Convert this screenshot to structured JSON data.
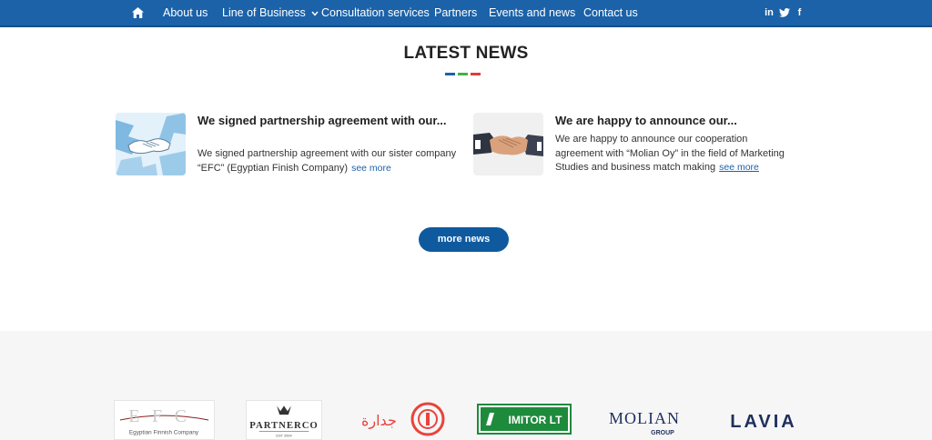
{
  "nav": {
    "home_icon": "home-icon",
    "items": [
      {
        "label": "About us"
      },
      {
        "label": "Line of Business",
        "icon": "chevron-down-icon"
      },
      {
        "label": "Consultation services"
      },
      {
        "label": "Partners"
      },
      {
        "label": "Events and news"
      },
      {
        "label": "Contact us"
      }
    ],
    "social": [
      {
        "label": "in",
        "icon": "linkedin-icon"
      },
      {
        "label": "",
        "icon": "twitter-icon"
      },
      {
        "label": "f",
        "icon": "facebook-icon"
      }
    ],
    "bg_color": "#1b62a8"
  },
  "latest_news": {
    "title": "LATEST NEWS",
    "dash_colors": [
      "#1b62a8",
      "#3cb44b",
      "#e23b3b"
    ],
    "cards": [
      {
        "title": "We signed partnership agreement with our...",
        "excerpt": "We signed partnership agreement with our sister company “EFC” (Egyptian Finish Company)",
        "see_more": "see more",
        "thumb_icon": "puzzle-handshake-image"
      },
      {
        "title": "We are happy to announce our...",
        "excerpt": "We are happy to announce our cooperation agreement with “Molian Oy” in the field of Marketing Studies and business match making",
        "see_more": "see more",
        "thumb_icon": "handshake-image"
      }
    ],
    "more_button": "more news"
  },
  "partners": {
    "logos": [
      {
        "name": "EFC",
        "caption": "Egyptian Finnish Company"
      },
      {
        "name": "PARTNERCO",
        "caption": "EST 2004"
      },
      {
        "name": "جدارة"
      },
      {
        "name": "IMITOR LT"
      },
      {
        "name": "MOLIAN",
        "caption": "GROUP"
      },
      {
        "name": "LAVIA"
      }
    ]
  }
}
